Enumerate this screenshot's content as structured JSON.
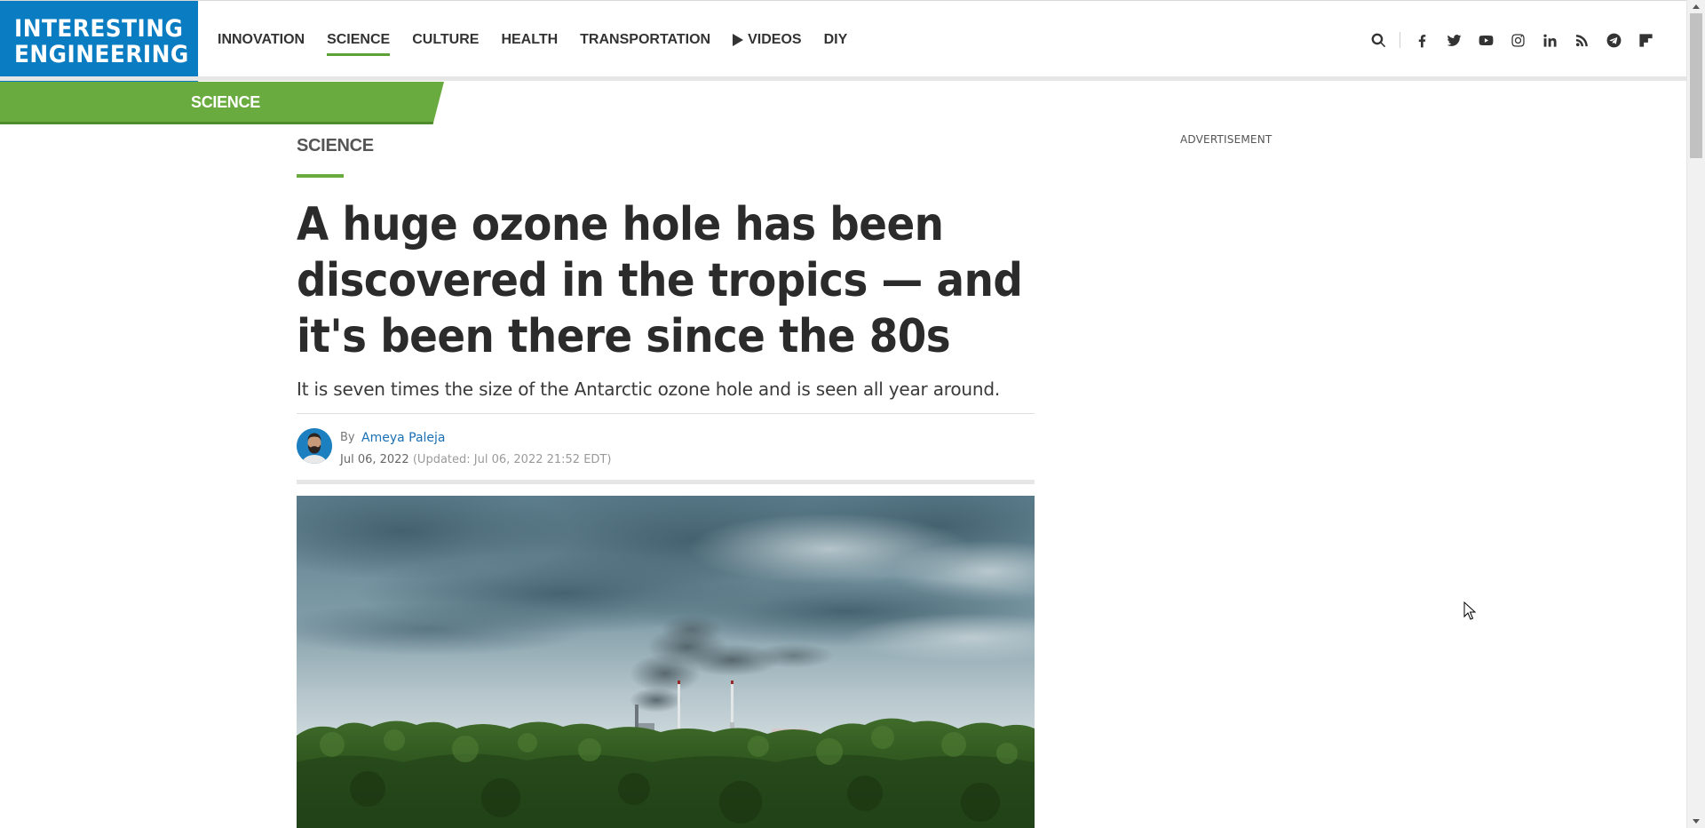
{
  "header": {
    "logo_line1": "INTERESTING",
    "logo_line2": "ENGINEERING",
    "nav": [
      {
        "label": "INNOVATION",
        "active": false
      },
      {
        "label": "SCIENCE",
        "active": true
      },
      {
        "label": "CULTURE",
        "active": false
      },
      {
        "label": "HEALTH",
        "active": false
      },
      {
        "label": "TRANSPORTATION",
        "active": false
      },
      {
        "label": "VIDEOS",
        "active": false,
        "icon": "play-icon"
      },
      {
        "label": "DIY",
        "active": false
      }
    ],
    "tools": [
      "search-icon",
      "facebook-icon",
      "twitter-icon",
      "youtube-icon",
      "instagram-icon",
      "linkedin-icon",
      "rss-icon",
      "telegram-icon",
      "flipboard-icon"
    ],
    "accent_color": "#5da035",
    "brand_color": "#0a7cc2"
  },
  "banner": {
    "label": "SCIENCE",
    "color": "#6aab3f"
  },
  "article": {
    "kicker": "SCIENCE",
    "headline": "A huge ozone hole has been discovered in the tropics — and it's been there since the 80s",
    "dek": "It is seven times the size of the Antarctic ozone hole and is seen all year around.",
    "byline": {
      "by": "By",
      "author": "Ameya Paleja",
      "date": "Jul 06, 2022",
      "updated": "(Updated: Jul 06, 2022 21:52 EDT)"
    }
  },
  "sidebar": {
    "ad_label": "ADVERTISEMENT"
  }
}
